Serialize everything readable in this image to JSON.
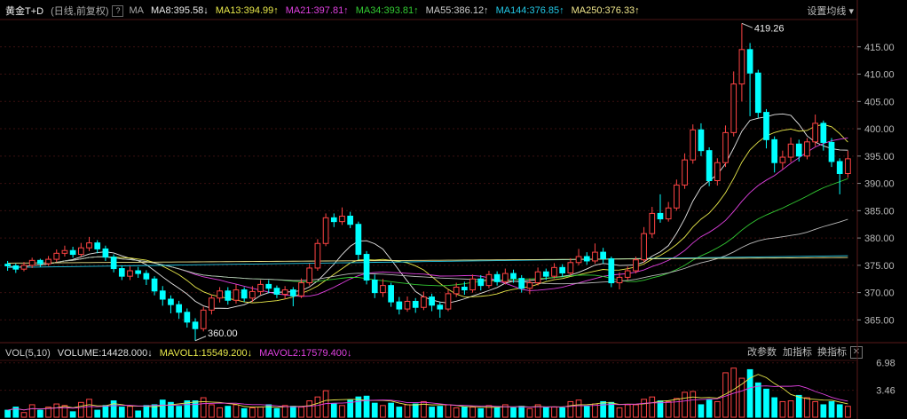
{
  "header": {
    "symbol": "黄金T+D",
    "period": "(日线,前复权)",
    "help": "?",
    "ma_label": "MA",
    "ma": [
      {
        "text": "MA8:395.58",
        "arrow": "↓",
        "color": "#e8e8e8"
      },
      {
        "text": "MA13:394.99",
        "arrow": "↑",
        "color": "#e8e84a"
      },
      {
        "text": "MA21:397.81",
        "arrow": "↑",
        "color": "#e040e0"
      },
      {
        "text": "MA34:393.81",
        "arrow": "↑",
        "color": "#33cc33"
      },
      {
        "text": "MA55:386.12",
        "arrow": "↑",
        "color": "#cccccc"
      },
      {
        "text": "MA144:376.85",
        "arrow": "↑",
        "color": "#22c8e6"
      },
      {
        "text": "MA250:376.33",
        "arrow": "↑",
        "color": "#f0e68c"
      }
    ],
    "settings": "设置均线"
  },
  "volume_header": {
    "vol": "VOL(5,10)",
    "volume": "VOLUME:14428.000",
    "volume_arrow": "↓",
    "mavol1": "MAVOL1:15549.200",
    "mavol1_arrow": "↓",
    "mavol2": "MAVOL2:17579.400",
    "mavol2_arrow": "↓",
    "btn_params": "改参数",
    "btn_add": "加指标",
    "btn_swap": "换指标",
    "btn_close": "✕"
  },
  "annotations": {
    "high": "419.26",
    "low": "360.00"
  },
  "colors": {
    "up": "#ff4444",
    "down": "#00ffff",
    "grid": "#3a1010",
    "axis": "#bbbbbb"
  },
  "chart_data": {
    "type": "candlestick",
    "price_ylim": [
      361,
      420
    ],
    "price_ticks": [
      365,
      370,
      375,
      380,
      385,
      390,
      395,
      400,
      405,
      410,
      415
    ],
    "price_tick_labels": [
      "365.00",
      "370.00",
      "375.00",
      "380.00",
      "385.00",
      "390.00",
      "395.00",
      "400.00",
      "405.00",
      "410.00",
      "415.00"
    ],
    "volume_ylim": [
      0,
      7.4
    ],
    "volume_tick_labels": [
      "3.46",
      "6.98"
    ],
    "candles": [
      [
        375.2,
        374.9,
        375.8,
        374.0
      ],
      [
        374.9,
        374.3,
        375.3,
        373.6
      ],
      [
        374.3,
        375.0,
        375.6,
        373.9
      ],
      [
        375.0,
        375.9,
        376.4,
        374.5
      ],
      [
        375.9,
        375.3,
        376.2,
        374.7
      ],
      [
        375.3,
        376.1,
        376.7,
        374.9
      ],
      [
        376.1,
        377.2,
        377.9,
        375.6
      ],
      [
        377.2,
        377.7,
        378.6,
        376.6
      ],
      [
        377.7,
        377.0,
        378.4,
        376.4
      ],
      [
        377.0,
        378.2,
        379.1,
        376.6
      ],
      [
        378.2,
        379.1,
        380.2,
        377.6
      ],
      [
        379.1,
        378.0,
        379.6,
        377.2
      ],
      [
        378.0,
        376.5,
        378.6,
        375.8
      ],
      [
        376.5,
        374.4,
        377.0,
        373.7
      ],
      [
        374.4,
        373.0,
        375.0,
        372.3
      ],
      [
        373.0,
        374.0,
        374.8,
        372.3
      ],
      [
        374.0,
        373.5,
        374.7,
        372.7
      ],
      [
        373.5,
        372.5,
        374.1,
        371.4
      ],
      [
        372.5,
        370.3,
        373.0,
        369.5
      ],
      [
        370.3,
        368.8,
        371.2,
        367.6
      ],
      [
        368.8,
        367.8,
        369.5,
        366.2
      ],
      [
        367.8,
        366.4,
        368.5,
        365.2
      ],
      [
        366.4,
        364.6,
        367.1,
        363.6
      ],
      [
        364.6,
        363.4,
        365.3,
        361.2
      ],
      [
        363.4,
        366.8,
        367.4,
        362.9
      ],
      [
        366.8,
        369.0,
        369.6,
        366.0
      ],
      [
        369.0,
        370.3,
        371.0,
        368.2
      ],
      [
        370.3,
        368.6,
        371.0,
        367.8
      ],
      [
        368.6,
        370.5,
        371.5,
        368.0
      ],
      [
        370.5,
        369.0,
        371.0,
        368.3
      ],
      [
        369.0,
        370.2,
        371.2,
        368.3
      ],
      [
        370.2,
        371.5,
        372.3,
        369.6
      ],
      [
        371.5,
        370.8,
        372.3,
        369.9
      ],
      [
        370.8,
        369.7,
        371.3,
        369.0
      ],
      [
        369.7,
        370.5,
        371.2,
        368.8
      ],
      [
        370.5,
        369.4,
        371.0,
        367.5
      ],
      [
        369.4,
        371.8,
        372.6,
        369.0
      ],
      [
        371.8,
        374.5,
        375.3,
        371.3
      ],
      [
        374.5,
        379.0,
        379.8,
        374.0
      ],
      [
        379.0,
        383.7,
        384.5,
        378.5
      ],
      [
        383.7,
        383.0,
        384.5,
        382.0
      ],
      [
        383.0,
        384.0,
        385.6,
        382.4
      ],
      [
        384.0,
        382.5,
        384.8,
        381.8
      ],
      [
        382.5,
        377.0,
        383.0,
        376.0
      ],
      [
        377.0,
        372.3,
        377.6,
        371.5
      ],
      [
        372.3,
        370.0,
        373.3,
        369.0
      ],
      [
        370.0,
        371.3,
        372.5,
        369.2
      ],
      [
        371.3,
        368.3,
        371.8,
        367.4
      ],
      [
        368.3,
        367.0,
        369.2,
        366.0
      ],
      [
        367.0,
        368.4,
        369.3,
        366.5
      ],
      [
        368.4,
        367.3,
        369.0,
        366.3
      ],
      [
        367.3,
        369.2,
        370.2,
        366.8
      ],
      [
        369.2,
        367.7,
        369.8,
        366.6
      ],
      [
        367.7,
        367.0,
        368.3,
        365.4
      ],
      [
        367.0,
        369.8,
        370.5,
        366.6
      ],
      [
        369.8,
        371.0,
        371.8,
        369.2
      ],
      [
        371.0,
        370.5,
        372.0,
        369.6
      ],
      [
        370.5,
        372.5,
        373.3,
        370.0
      ],
      [
        372.5,
        371.3,
        373.2,
        370.4
      ],
      [
        371.3,
        373.3,
        374.0,
        370.8
      ],
      [
        373.3,
        372.0,
        373.9,
        371.3
      ],
      [
        372.0,
        373.5,
        374.4,
        371.5
      ],
      [
        373.5,
        372.6,
        374.2,
        371.8
      ],
      [
        372.6,
        370.8,
        373.2,
        370.0
      ],
      [
        370.8,
        371.8,
        372.6,
        369.7
      ],
      [
        371.8,
        373.8,
        374.6,
        371.3
      ],
      [
        373.8,
        373.0,
        374.4,
        372.3
      ],
      [
        373.0,
        374.6,
        375.4,
        372.6
      ],
      [
        374.6,
        373.6,
        375.2,
        372.9
      ],
      [
        373.6,
        375.5,
        376.3,
        373.1
      ],
      [
        375.5,
        376.6,
        378.0,
        375.0
      ],
      [
        376.6,
        375.8,
        377.4,
        375.1
      ],
      [
        375.8,
        377.4,
        379.0,
        375.3
      ],
      [
        377.4,
        376.2,
        378.2,
        375.3
      ],
      [
        376.2,
        371.8,
        376.6,
        371.0
      ],
      [
        371.8,
        372.8,
        373.7,
        370.6
      ],
      [
        372.8,
        374.0,
        374.8,
        372.3
      ],
      [
        374.0,
        376.0,
        376.6,
        373.5
      ],
      [
        376.0,
        380.8,
        382.0,
        375.5
      ],
      [
        380.8,
        384.5,
        385.7,
        380.0
      ],
      [
        384.5,
        383.5,
        388.0,
        382.8
      ],
      [
        383.5,
        385.5,
        386.6,
        383.0
      ],
      [
        385.5,
        389.7,
        390.7,
        385.0
      ],
      [
        389.7,
        394.3,
        395.5,
        389.0
      ],
      [
        394.3,
        399.8,
        400.8,
        393.6
      ],
      [
        399.8,
        396.0,
        401.0,
        395.0
      ],
      [
        396.0,
        390.5,
        396.6,
        389.5
      ],
      [
        390.5,
        393.8,
        394.6,
        389.6
      ],
      [
        393.8,
        399.3,
        400.6,
        393.0
      ],
      [
        399.3,
        408.2,
        410.5,
        398.6
      ],
      [
        408.2,
        414.5,
        419.3,
        405.0
      ],
      [
        414.5,
        410.2,
        415.7,
        402.3
      ],
      [
        410.2,
        403.0,
        410.8,
        402.0
      ],
      [
        403.0,
        398.0,
        403.6,
        396.4
      ],
      [
        398.0,
        393.8,
        398.6,
        392.0
      ],
      [
        393.8,
        394.8,
        396.0,
        392.6
      ],
      [
        394.8,
        397.2,
        398.4,
        393.9
      ],
      [
        397.2,
        395.0,
        398.0,
        394.0
      ],
      [
        395.0,
        397.6,
        398.3,
        394.4
      ],
      [
        397.6,
        401.0,
        402.6,
        396.8
      ],
      [
        401.0,
        397.5,
        401.5,
        396.0
      ],
      [
        397.5,
        394.0,
        398.3,
        393.0
      ],
      [
        394.0,
        391.8,
        394.6,
        388.0
      ],
      [
        391.8,
        394.5,
        396.0,
        391.0
      ]
    ],
    "volume": [
      0.9,
      1.3,
      0.6,
      1.6,
      0.9,
      1.3,
      1.7,
      1.5,
      0.7,
      1.9,
      2.3,
      0.9,
      1.5,
      2.1,
      1.3,
      1.4,
      0.8,
      1.5,
      1.6,
      2.2,
      1.9,
      1.4,
      2.1,
      2.1,
      2.5,
      1.6,
      1.2,
      1.4,
      1.6,
      1.1,
      1.2,
      1.3,
      1.6,
      1.1,
      1.5,
      1.4,
      1.3,
      2.1,
      2.6,
      3.4,
      1.7,
      1.5,
      2.2,
      2.6,
      2.7,
      1.8,
      1.5,
      1.8,
      1.3,
      1.6,
      1.7,
      2.0,
      1.3,
      1.4,
      1.6,
      1.2,
      1.3,
      1.3,
      1.1,
      1.5,
      1.2,
      1.6,
      1.2,
      1.4,
      1.1,
      1.6,
      1.3,
      1.3,
      1.2,
      2.0,
      2.2,
      1.4,
      1.7,
      2.0,
      1.9,
      1.2,
      1.6,
      1.6,
      2.3,
      2.6,
      2.1,
      2.0,
      2.4,
      3.2,
      3.3,
      1.6,
      2.2,
      2.0,
      5.7,
      6.3,
      5.0,
      6.1,
      4.4,
      3.6,
      2.5,
      2.0,
      2.1,
      2.8,
      2.5,
      2.0,
      1.6,
      2.0,
      1.6,
      1.4
    ]
  }
}
